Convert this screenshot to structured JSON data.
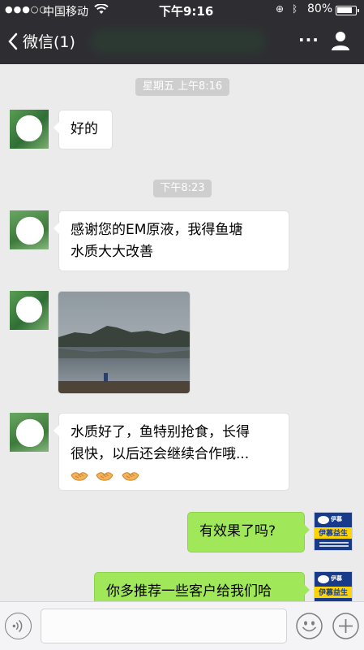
{
  "status_bar": {
    "signal": "●●●○○",
    "carrier": "中国移动",
    "time": "下午9:16",
    "battery": "80%",
    "battery_level": 0.8
  },
  "nav": {
    "back_label": "微信(1)",
    "more_label": "···"
  },
  "chat": {
    "stamps": [
      "星期五 上午8:16",
      "下午8:23"
    ],
    "messages": [
      {
        "from": "them",
        "text": "好的"
      },
      {
        "from": "them",
        "text_lines": [
          "感谢您的EM原液，我得鱼塘",
          "水质大大改善"
        ]
      },
      {
        "from": "them",
        "type": "image",
        "description": "lake photo"
      },
      {
        "from": "them",
        "text_lines": [
          "水质好了，鱼特别抢食，长得",
          "很快，以后还会继续合作哦..."
        ],
        "emoji": [
          "handshake-emoji",
          "handshake-emoji",
          "handshake-emoji"
        ]
      },
      {
        "from": "me",
        "text": "有效果了吗?"
      },
      {
        "from": "me",
        "text": "你多推荐一些客户给我们哈"
      }
    ],
    "my_avatar": {
      "logo_text": "伊慕",
      "band_text": "伊慕益生菌"
    }
  },
  "input_bar": {
    "placeholder": ""
  },
  "colors": {
    "nav_bg": "#2e2e32",
    "chat_bg": "#ebebeb",
    "my_bubble": "#a0e75a",
    "their_bubble": "#ffffff"
  }
}
